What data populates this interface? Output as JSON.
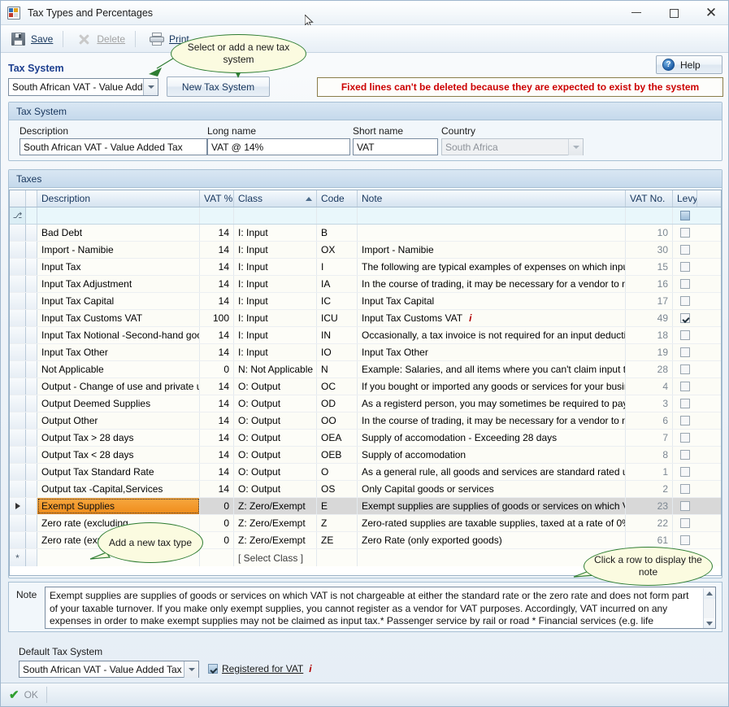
{
  "window": {
    "title": "Tax Types and Percentages",
    "icon": "app-grid-icon",
    "minimize": "–",
    "maximize": "□",
    "close": "✕"
  },
  "toolbar": {
    "save_label": "Save",
    "delete_label": "Delete",
    "print_label": "Print"
  },
  "tax_system_selector": {
    "label": "Tax System",
    "selected": "South African VAT - Value Adde...",
    "new_button": "New Tax System",
    "warning": "Fixed lines can't be deleted because they are expected to exist by the system",
    "help_button": "Help",
    "help_orb": "?"
  },
  "tax_system_group": {
    "title": "Tax System",
    "fields": [
      {
        "label": "Description",
        "value": "South African VAT - Value Added Tax"
      },
      {
        "label": "Long name",
        "value": "VAT @ 14%"
      },
      {
        "label": "Short name",
        "value": "VAT"
      },
      {
        "label": "Country",
        "value": "South Africa"
      }
    ]
  },
  "taxes_group": {
    "title": "Taxes",
    "columns": [
      "Description",
      "VAT %",
      "Class",
      "Code",
      "Note",
      "VAT No.",
      "Levy"
    ],
    "sorted_column": "Class",
    "sort_direction": "asc",
    "filter_row_icon": "filter-icon",
    "new_row_icon": "*",
    "new_row_class_placeholder": "[ Select Class ]",
    "rows": [
      {
        "desc": "Bad Debt",
        "vat": "14",
        "class": "I: Input",
        "code": "B",
        "note": "",
        "vatno": "10",
        "levy": false,
        "selected": false
      },
      {
        "desc": "Import - Namibie",
        "vat": "14",
        "class": "I: Input",
        "code": "OX",
        "note": "Import - Namibie",
        "vatno": "30",
        "levy": false,
        "selected": false
      },
      {
        "desc": "Input Tax",
        "vat": "14",
        "class": "I: Input",
        "code": "I",
        "note": "The following are typical examples of expenses on which input t...",
        "vatno": "15",
        "levy": false,
        "selected": false
      },
      {
        "desc": "Input Tax Adjustment",
        "vat": "14",
        "class": "I: Input",
        "code": "IA",
        "note": "In the course of trading, it may be necessary for a vendor to m...",
        "vatno": "16",
        "levy": false,
        "selected": false
      },
      {
        "desc": "Input Tax Capital",
        "vat": "14",
        "class": "I: Input",
        "code": "IC",
        "note": "Input Tax Capital",
        "vatno": "17",
        "levy": false,
        "selected": false
      },
      {
        "desc": "Input Tax Customs VAT",
        "vat": "100",
        "class": "I: Input",
        "code": "ICU",
        "note": "Input Tax Customs VAT",
        "note_info": "i",
        "vatno": "49",
        "levy": true,
        "selected": false
      },
      {
        "desc": "Input Tax Notional -Second-hand goods",
        "vat": "14",
        "class": "I: Input",
        "code": "IN",
        "note": "Occasionally, a tax invoice is not required for an input deduction...",
        "vatno": "18",
        "levy": false,
        "selected": false
      },
      {
        "desc": "Input Tax Other",
        "vat": "14",
        "class": "I: Input",
        "code": "IO",
        "note": "Input Tax Other",
        "vatno": "19",
        "levy": false,
        "selected": false
      },
      {
        "desc": "Not Applicable",
        "vat": "0",
        "class": "N: Not Applicable",
        "code": "N",
        "note": "Example: Salaries, and all items where you can't claim input tax.",
        "vatno": "28",
        "levy": false,
        "selected": false
      },
      {
        "desc": "Output - Change of use and private use",
        "vat": "14",
        "class": "O: Output",
        "code": "OC",
        "note": "If you bought or imported any goods or services for your busine...",
        "vatno": "4",
        "levy": false,
        "selected": false
      },
      {
        "desc": "Output Deemed Supplies",
        "vat": "14",
        "class": "O: Output",
        "code": "OD",
        "note": "As a registerd person, you may sometimes be required to pay o...",
        "vatno": "3",
        "levy": false,
        "selected": false
      },
      {
        "desc": "Output Other",
        "vat": "14",
        "class": "O: Output",
        "code": "OO",
        "note": "In the course of trading, it may be necessary for a vendor to m...",
        "vatno": "6",
        "levy": false,
        "selected": false
      },
      {
        "desc": "Output Tax  > 28 days",
        "vat": "14",
        "class": "O: Output",
        "code": "OEA",
        "note": "Supply of accomodation - Exceeding 28 days",
        "vatno": "7",
        "levy": false,
        "selected": false
      },
      {
        "desc": "Output Tax < 28 days",
        "vat": "14",
        "class": "O: Output",
        "code": "OEB",
        "note": "Supply of accomodation",
        "vatno": "8",
        "levy": false,
        "selected": false
      },
      {
        "desc": "Output Tax Standard Rate",
        "vat": "14",
        "class": "O: Output",
        "code": "O",
        "note": "As a general rule, all goods and services are standard rated unl...",
        "vatno": "1",
        "levy": false,
        "selected": false
      },
      {
        "desc": "Output tax -Capital,Services",
        "vat": "14",
        "class": "O: Output",
        "code": "OS",
        "note": "Only Capital goods or services",
        "vatno": "2",
        "levy": false,
        "selected": false
      },
      {
        "desc": "Exempt Supplies",
        "vat": "0",
        "class": "Z: Zero/Exempt",
        "code": "E",
        "note": "Exempt supplies are supplies of goods or services on which VAT i...",
        "vatno": "23",
        "levy": false,
        "selected": true
      },
      {
        "desc": "Zero rate (excluding",
        "vat": "0",
        "class": "Z: Zero/Exempt",
        "code": "Z",
        "note": "Zero-rated supplies are taxable supplies, taxed at a rate of 0%....",
        "vatno": "22",
        "levy": false,
        "selected": false
      },
      {
        "desc": "Zero rate (expor",
        "vat": "0",
        "class": "Z: Zero/Exempt",
        "code": "ZE",
        "note": "Zero Rate (only exported goods)",
        "vatno": "61",
        "levy": false,
        "selected": false
      }
    ]
  },
  "note_panel": {
    "label": "Note",
    "text": "Exempt supplies are supplies of goods or services on which VAT is not chargeable at either the standard rate or the zero rate and does not form part of your taxable turnover. If you make only exempt supplies, you cannot register as a vendor for VAT purposes. Accordingly, VAT incurred on any expenses in order to make exempt supplies may not be claimed as input tax.* Passenger service by rail or road * Financial services (e.g. life insurance, medical schemes. etc.)*"
  },
  "default_tax_system": {
    "label": "Default Tax System",
    "value": "South African VAT - Value Added Tax",
    "registered_label": "Registered for VAT",
    "registered_info": "i",
    "registered_checked": true
  },
  "statusbar": {
    "ok_label": "OK"
  },
  "callouts": [
    {
      "id": "select-or-add",
      "text": "Select or add a new tax system"
    },
    {
      "id": "add-new-tax-type",
      "text": "Add a new tax type"
    },
    {
      "id": "click-row-note",
      "text": "Click a row to display the note"
    }
  ],
  "colors": {
    "accent_blue": "#1d3f8f",
    "warning_red": "#cc0000",
    "selection_orange": "#ef8c1a",
    "callout_green": "#2e7d32",
    "callout_fill": "#fbfbe0"
  }
}
